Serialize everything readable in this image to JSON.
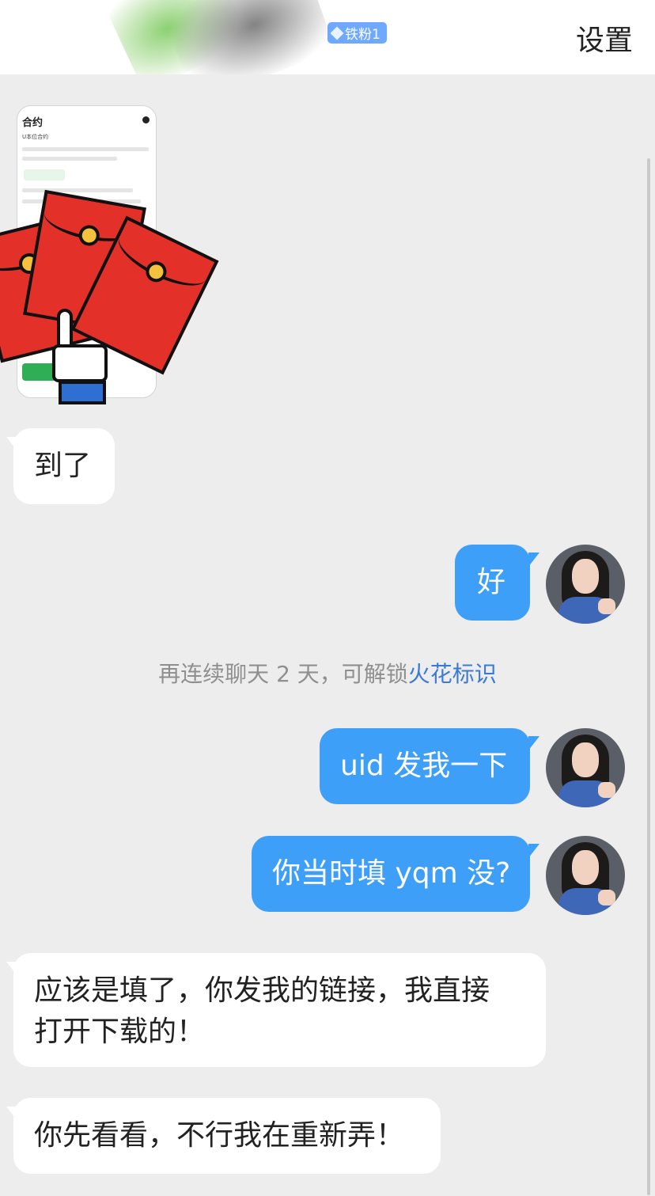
{
  "header": {
    "fan_badge": "铁粉1",
    "settings_label": "设置"
  },
  "sticker": {
    "phone_title": "合约",
    "phone_tab": "U本位合约"
  },
  "messages": [
    {
      "side": "left",
      "text": "到了"
    },
    {
      "side": "right",
      "text": "好"
    },
    {
      "side": "right",
      "text": "uid 发我一下"
    },
    {
      "side": "right",
      "text": "你当时填 yqm 没?"
    },
    {
      "side": "left",
      "text": "应该是填了，你发我的链接，我直接打开下载的！"
    },
    {
      "side": "left",
      "text": "你先看看，不行我在重新弄！"
    }
  ],
  "notice": {
    "prefix": "再连续聊天 2 天，可解锁",
    "link": "火花标识"
  },
  "colors": {
    "background": "#ededee",
    "bubble_right": "#3d9ff7",
    "bubble_left": "#ffffff",
    "badge": "#6fa9ff",
    "notice_link": "#3a7ad6"
  }
}
